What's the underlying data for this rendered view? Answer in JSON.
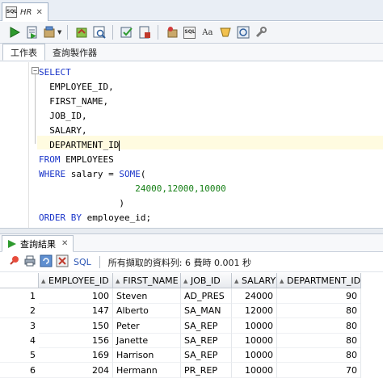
{
  "tab": {
    "title": "HR",
    "icon": "sql-worksheet-icon"
  },
  "toolbar": {
    "icons": [
      "run-statement-icon",
      "run-script-icon",
      "commit-icon",
      "rollback-icon",
      "explain-plan-icon",
      "autotrace-icon",
      "unshared-sql-worksheet-icon",
      "clear-icon",
      "sql-tuning-advisor-icon",
      "to-upper-icon",
      "sql-history-icon",
      "find-icon",
      "tools-icon"
    ]
  },
  "subtabs": [
    "工作表",
    "查詢製作器"
  ],
  "editor": {
    "lines": [
      [
        {
          "t": "SELECT",
          "c": "kw"
        }
      ],
      [
        {
          "t": "  EMPLOYEE_ID,",
          "c": ""
        }
      ],
      [
        {
          "t": "  FIRST_NAME,",
          "c": ""
        }
      ],
      [
        {
          "t": "  JOB_ID,",
          "c": ""
        }
      ],
      [
        {
          "t": "  SALARY,",
          "c": ""
        }
      ],
      [
        {
          "t": "  DEPARTMENT_ID",
          "c": ""
        }
      ],
      [
        {
          "t": "FROM",
          "c": "kw"
        },
        {
          "t": " EMPLOYEES",
          "c": ""
        }
      ],
      [
        {
          "t": "WHERE",
          "c": "kw"
        },
        {
          "t": " salary = ",
          "c": ""
        },
        {
          "t": "SOME",
          "c": "kw"
        },
        {
          "t": "(",
          "c": ""
        }
      ],
      [
        {
          "t": "                  24000,12000,10000",
          "c": "num"
        }
      ],
      [
        {
          "t": "               )",
          "c": ""
        }
      ],
      [
        {
          "t": "ORDER BY",
          "c": "kw"
        },
        {
          "t": " employee_id;",
          "c": ""
        }
      ]
    ]
  },
  "results": {
    "tab_label": "查詢結果",
    "sql_label": "SQL",
    "status": "所有擷取的資料列: 6 費時 0.001 秒",
    "columns": [
      "EMPLOYEE_ID",
      "FIRST_NAME",
      "JOB_ID",
      "SALARY",
      "DEPARTMENT_ID"
    ],
    "rows": [
      [
        "1",
        "100",
        "Steven",
        "AD_PRES",
        "24000",
        "90"
      ],
      [
        "2",
        "147",
        "Alberto",
        "SA_MAN",
        "12000",
        "80"
      ],
      [
        "3",
        "150",
        "Peter",
        "SA_REP",
        "10000",
        "80"
      ],
      [
        "4",
        "156",
        "Janette",
        "SA_REP",
        "10000",
        "80"
      ],
      [
        "5",
        "169",
        "Harrison",
        "SA_REP",
        "10000",
        "80"
      ],
      [
        "6",
        "204",
        "Hermann",
        "PR_REP",
        "10000",
        "70"
      ]
    ]
  }
}
